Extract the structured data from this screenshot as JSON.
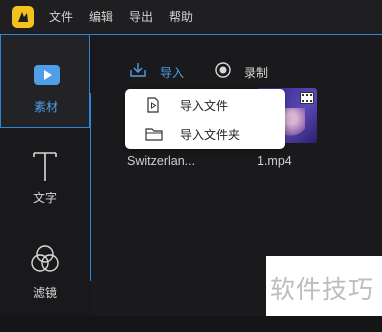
{
  "menubar": {
    "items": [
      "文件",
      "编辑",
      "导出",
      "帮助"
    ]
  },
  "sidebar": {
    "items": [
      {
        "label": "素材",
        "icon": "media-icon",
        "active": true
      },
      {
        "label": "文字",
        "icon": "text-icon"
      },
      {
        "label": "滤镜",
        "icon": "filter-icon"
      }
    ]
  },
  "toolbar": {
    "import_label": "导入",
    "record_label": "录制"
  },
  "import_menu": {
    "items": [
      {
        "label": "导入文件",
        "icon": "file-video-icon"
      },
      {
        "label": "导入文件夹",
        "icon": "folder-icon"
      }
    ]
  },
  "media": {
    "items": [
      {
        "name": "Switzerlan..."
      },
      {
        "name": "1.mp4"
      }
    ]
  },
  "watermark": {
    "text": "软件技巧"
  },
  "colors": {
    "accent": "#2c86d8",
    "accent_text": "#4f9fe8",
    "logo": "#f4c21c"
  }
}
